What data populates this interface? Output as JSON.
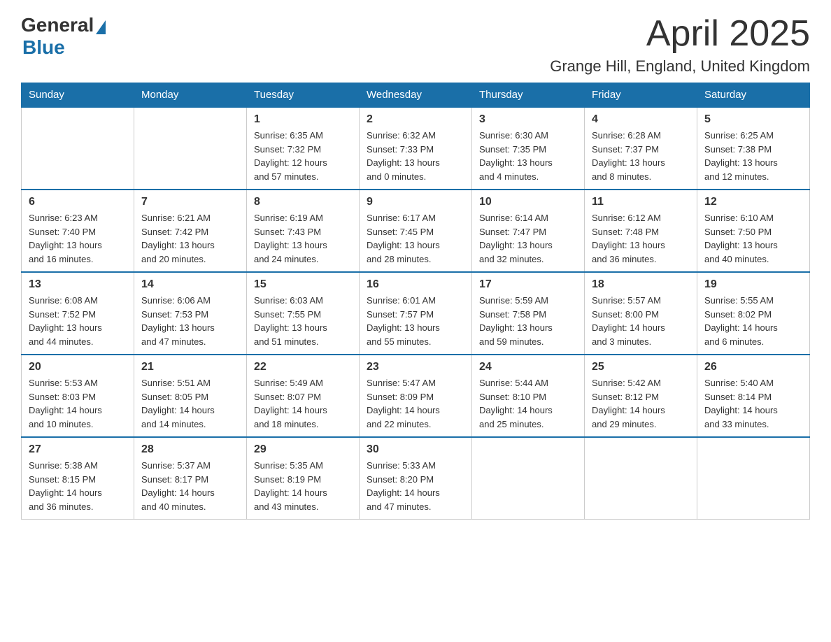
{
  "header": {
    "logo_general": "General",
    "logo_blue": "Blue",
    "month": "April 2025",
    "location": "Grange Hill, England, United Kingdom"
  },
  "days_of_week": [
    "Sunday",
    "Monday",
    "Tuesday",
    "Wednesday",
    "Thursday",
    "Friday",
    "Saturday"
  ],
  "weeks": [
    [
      {
        "day": "",
        "info": ""
      },
      {
        "day": "",
        "info": ""
      },
      {
        "day": "1",
        "info": "Sunrise: 6:35 AM\nSunset: 7:32 PM\nDaylight: 12 hours\nand 57 minutes."
      },
      {
        "day": "2",
        "info": "Sunrise: 6:32 AM\nSunset: 7:33 PM\nDaylight: 13 hours\nand 0 minutes."
      },
      {
        "day": "3",
        "info": "Sunrise: 6:30 AM\nSunset: 7:35 PM\nDaylight: 13 hours\nand 4 minutes."
      },
      {
        "day": "4",
        "info": "Sunrise: 6:28 AM\nSunset: 7:37 PM\nDaylight: 13 hours\nand 8 minutes."
      },
      {
        "day": "5",
        "info": "Sunrise: 6:25 AM\nSunset: 7:38 PM\nDaylight: 13 hours\nand 12 minutes."
      }
    ],
    [
      {
        "day": "6",
        "info": "Sunrise: 6:23 AM\nSunset: 7:40 PM\nDaylight: 13 hours\nand 16 minutes."
      },
      {
        "day": "7",
        "info": "Sunrise: 6:21 AM\nSunset: 7:42 PM\nDaylight: 13 hours\nand 20 minutes."
      },
      {
        "day": "8",
        "info": "Sunrise: 6:19 AM\nSunset: 7:43 PM\nDaylight: 13 hours\nand 24 minutes."
      },
      {
        "day": "9",
        "info": "Sunrise: 6:17 AM\nSunset: 7:45 PM\nDaylight: 13 hours\nand 28 minutes."
      },
      {
        "day": "10",
        "info": "Sunrise: 6:14 AM\nSunset: 7:47 PM\nDaylight: 13 hours\nand 32 minutes."
      },
      {
        "day": "11",
        "info": "Sunrise: 6:12 AM\nSunset: 7:48 PM\nDaylight: 13 hours\nand 36 minutes."
      },
      {
        "day": "12",
        "info": "Sunrise: 6:10 AM\nSunset: 7:50 PM\nDaylight: 13 hours\nand 40 minutes."
      }
    ],
    [
      {
        "day": "13",
        "info": "Sunrise: 6:08 AM\nSunset: 7:52 PM\nDaylight: 13 hours\nand 44 minutes."
      },
      {
        "day": "14",
        "info": "Sunrise: 6:06 AM\nSunset: 7:53 PM\nDaylight: 13 hours\nand 47 minutes."
      },
      {
        "day": "15",
        "info": "Sunrise: 6:03 AM\nSunset: 7:55 PM\nDaylight: 13 hours\nand 51 minutes."
      },
      {
        "day": "16",
        "info": "Sunrise: 6:01 AM\nSunset: 7:57 PM\nDaylight: 13 hours\nand 55 minutes."
      },
      {
        "day": "17",
        "info": "Sunrise: 5:59 AM\nSunset: 7:58 PM\nDaylight: 13 hours\nand 59 minutes."
      },
      {
        "day": "18",
        "info": "Sunrise: 5:57 AM\nSunset: 8:00 PM\nDaylight: 14 hours\nand 3 minutes."
      },
      {
        "day": "19",
        "info": "Sunrise: 5:55 AM\nSunset: 8:02 PM\nDaylight: 14 hours\nand 6 minutes."
      }
    ],
    [
      {
        "day": "20",
        "info": "Sunrise: 5:53 AM\nSunset: 8:03 PM\nDaylight: 14 hours\nand 10 minutes."
      },
      {
        "day": "21",
        "info": "Sunrise: 5:51 AM\nSunset: 8:05 PM\nDaylight: 14 hours\nand 14 minutes."
      },
      {
        "day": "22",
        "info": "Sunrise: 5:49 AM\nSunset: 8:07 PM\nDaylight: 14 hours\nand 18 minutes."
      },
      {
        "day": "23",
        "info": "Sunrise: 5:47 AM\nSunset: 8:09 PM\nDaylight: 14 hours\nand 22 minutes."
      },
      {
        "day": "24",
        "info": "Sunrise: 5:44 AM\nSunset: 8:10 PM\nDaylight: 14 hours\nand 25 minutes."
      },
      {
        "day": "25",
        "info": "Sunrise: 5:42 AM\nSunset: 8:12 PM\nDaylight: 14 hours\nand 29 minutes."
      },
      {
        "day": "26",
        "info": "Sunrise: 5:40 AM\nSunset: 8:14 PM\nDaylight: 14 hours\nand 33 minutes."
      }
    ],
    [
      {
        "day": "27",
        "info": "Sunrise: 5:38 AM\nSunset: 8:15 PM\nDaylight: 14 hours\nand 36 minutes."
      },
      {
        "day": "28",
        "info": "Sunrise: 5:37 AM\nSunset: 8:17 PM\nDaylight: 14 hours\nand 40 minutes."
      },
      {
        "day": "29",
        "info": "Sunrise: 5:35 AM\nSunset: 8:19 PM\nDaylight: 14 hours\nand 43 minutes."
      },
      {
        "day": "30",
        "info": "Sunrise: 5:33 AM\nSunset: 8:20 PM\nDaylight: 14 hours\nand 47 minutes."
      },
      {
        "day": "",
        "info": ""
      },
      {
        "day": "",
        "info": ""
      },
      {
        "day": "",
        "info": ""
      }
    ]
  ]
}
